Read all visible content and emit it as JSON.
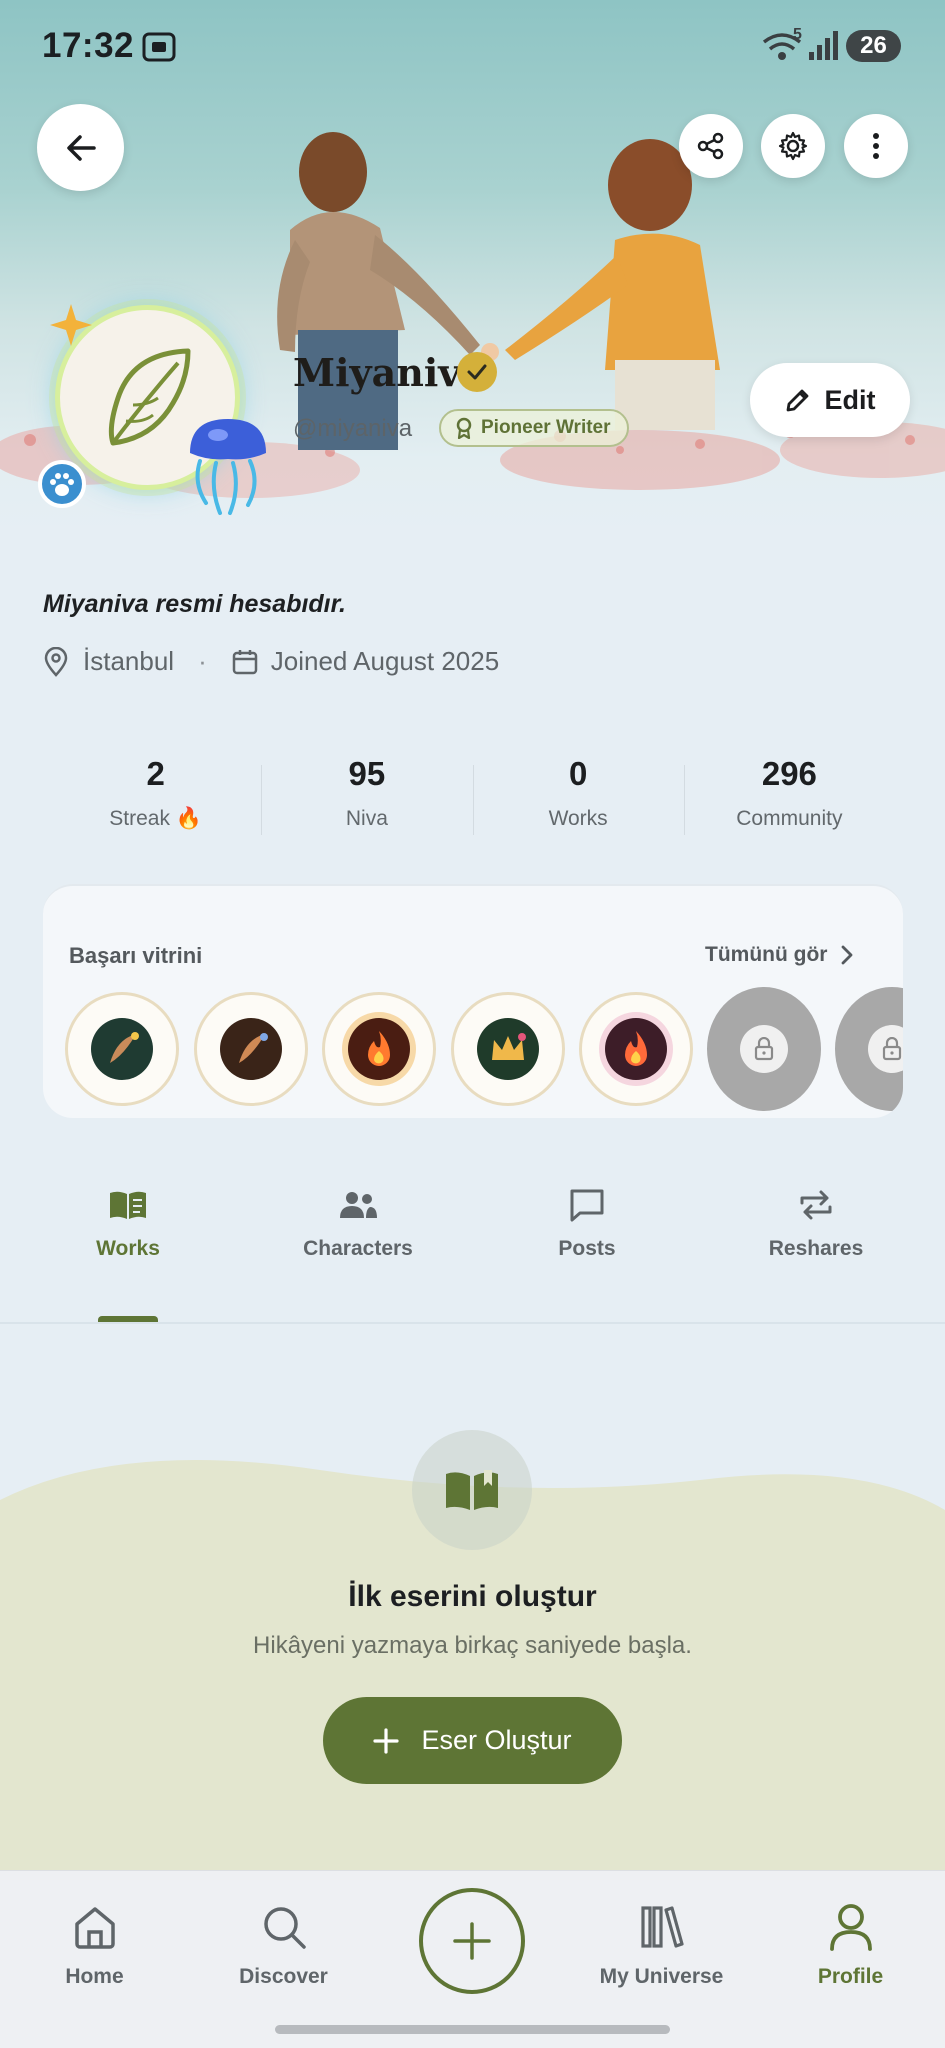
{
  "status_bar": {
    "time": "17:32",
    "battery": "26",
    "wifi_badge": "5"
  },
  "profile": {
    "name": "Miyaniva",
    "handle": "@miyaniva",
    "badge": "Pioneer Writer",
    "edit_label": "Edit",
    "bio": "Miyaniva resmi hesabıdır.",
    "location": "İstanbul",
    "separator": "·",
    "joined": "Joined August 2025"
  },
  "stats": [
    {
      "value": "2",
      "label": "Streak 🔥"
    },
    {
      "value": "95",
      "label": "Niva"
    },
    {
      "value": "0",
      "label": "Works"
    },
    {
      "value": "296",
      "label": "Community"
    }
  ],
  "achievements": {
    "title": "Başarı vitrini",
    "see_all": "Tümünü gör",
    "badges": [
      {
        "icon": "quill-icon",
        "color": "#1f3b32"
      },
      {
        "icon": "quill-icon",
        "color": "#3a2418"
      },
      {
        "icon": "flame-icon",
        "color": "#4a1d12"
      },
      {
        "icon": "crown-icon",
        "color": "#1f3b2a"
      },
      {
        "icon": "flame-icon",
        "color": "#3d1d28"
      },
      {
        "icon": "lock-icon",
        "locked": true
      },
      {
        "icon": "lock-icon",
        "locked": true
      }
    ]
  },
  "tabs": [
    {
      "label": "Works",
      "icon": "book-icon",
      "active": true
    },
    {
      "label": "Characters",
      "icon": "people-icon",
      "active": false
    },
    {
      "label": "Posts",
      "icon": "chat-icon",
      "active": false
    },
    {
      "label": "Reshares",
      "icon": "repeat-icon",
      "active": false
    }
  ],
  "empty_state": {
    "title": "İlk eserini oluştur",
    "subtitle": "Hikâyeni yazmaya birkaç saniyede başla.",
    "button": "Eser Oluştur"
  },
  "bottom_nav": [
    {
      "label": "Home",
      "icon": "home-icon",
      "active": false
    },
    {
      "label": "Discover",
      "icon": "search-icon",
      "active": false
    },
    {
      "label": "My Universe",
      "icon": "library-icon",
      "active": false
    },
    {
      "label": "Profile",
      "icon": "person-icon",
      "active": true
    }
  ],
  "colors": {
    "accent": "#5e7535",
    "verified": "#d4b03a",
    "paw_badge": "#3b8fcf"
  }
}
